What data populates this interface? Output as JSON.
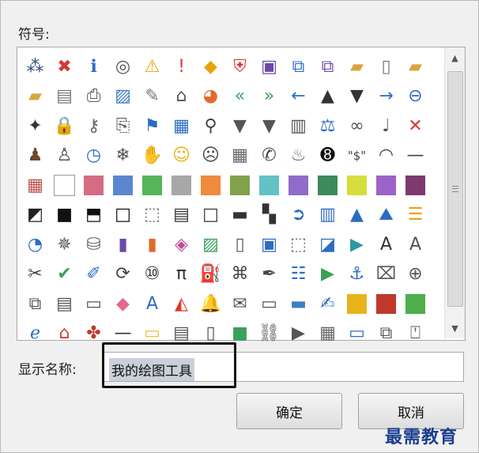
{
  "dialog": {
    "symbols_label": "符号:",
    "display_name_label": "显示名称:",
    "display_name_value": "我的绘图工具",
    "ok_button": "确定",
    "cancel_button": "取消",
    "watermark": "最需教育"
  },
  "scrollbar": {
    "up_arrow": "▲",
    "down_arrow": "▼"
  },
  "symbols": [
    {
      "name": "org-chart-icon",
      "glyph": "⁂",
      "color": "#2b4a78"
    },
    {
      "name": "error-icon",
      "glyph": "✖",
      "color": "#d23a3a"
    },
    {
      "name": "info-icon",
      "glyph": "ℹ",
      "color": "#2b6cc4"
    },
    {
      "name": "target-icon",
      "glyph": "◎",
      "color": "#555555"
    },
    {
      "name": "warning-icon",
      "glyph": "⚠",
      "color": "#e8a20c"
    },
    {
      "name": "exclamation-icon",
      "glyph": "!",
      "color": "#d23a3a"
    },
    {
      "name": "warning-diamond-icon",
      "glyph": "◆",
      "color": "#e8a20c"
    },
    {
      "name": "shield-icon",
      "glyph": "⛨",
      "color": "#d23a3a"
    },
    {
      "name": "save-icon",
      "glyph": "▣",
      "color": "#6b4aa6"
    },
    {
      "name": "save-as-icon",
      "glyph": "⧉",
      "color": "#2b6cc4"
    },
    {
      "name": "save-all-icon",
      "glyph": "⧉",
      "color": "#6b4aa6"
    },
    {
      "name": "folder-icon",
      "glyph": "▰",
      "color": "#d9a441"
    },
    {
      "name": "document-icon",
      "glyph": "▯",
      "color": "#777777"
    },
    {
      "name": "folder-open-icon",
      "glyph": "▰",
      "color": "#d9a441"
    },
    {
      "name": "folders-icon",
      "glyph": "▰",
      "color": "#d9a441"
    },
    {
      "name": "file-manager-icon",
      "glyph": "▤",
      "color": "#777777"
    },
    {
      "name": "printer-icon",
      "glyph": "⎙",
      "color": "#555555"
    },
    {
      "name": "picture-icon",
      "glyph": "▨",
      "color": "#3b7fc4"
    },
    {
      "name": "notes-icon",
      "glyph": "✎",
      "color": "#777777"
    },
    {
      "name": "home-icon",
      "glyph": "⌂",
      "color": "#555555"
    },
    {
      "name": "pie-chart-icon",
      "glyph": "◕",
      "color": "#e06a2a"
    },
    {
      "name": "rewind-icon",
      "glyph": "«",
      "color": "#3aa05a"
    },
    {
      "name": "fast-forward-icon",
      "glyph": "»",
      "color": "#3aa05a"
    },
    {
      "name": "arrow-left-icon",
      "glyph": "←",
      "color": "#2b6cc4"
    },
    {
      "name": "triangle-up-icon",
      "glyph": "▲",
      "color": "#333333"
    },
    {
      "name": "triangle-down-icon",
      "glyph": "▼",
      "color": "#333333"
    },
    {
      "name": "arrow-right-icon",
      "glyph": "→",
      "color": "#2b6cc4"
    },
    {
      "name": "back-circle-icon",
      "glyph": "⊖",
      "color": "#2b6cc4"
    },
    {
      "name": "pin-icon",
      "glyph": "✦",
      "color": "#333333"
    },
    {
      "name": "lock-icon",
      "glyph": "🔒",
      "color": "#d9a441"
    },
    {
      "name": "key-icon",
      "glyph": "⚷",
      "color": "#666666"
    },
    {
      "name": "scroll-icon",
      "glyph": "⎘",
      "color": "#555555"
    },
    {
      "name": "flag-icon",
      "glyph": "⚑",
      "color": "#2b6cc4"
    },
    {
      "name": "table-icon",
      "glyph": "▦",
      "color": "#2b6cc4"
    },
    {
      "name": "magnifier-icon",
      "glyph": "⚲",
      "color": "#444444"
    },
    {
      "name": "filter-icon",
      "glyph": "▼",
      "color": "#555555"
    },
    {
      "name": "filter-icon",
      "glyph": "▼",
      "color": "#555555"
    },
    {
      "name": "book-icon",
      "glyph": "▥",
      "color": "#555555"
    },
    {
      "name": "scales-icon",
      "glyph": "⚖",
      "color": "#2b6cc4"
    },
    {
      "name": "rings-icon",
      "glyph": "∞",
      "color": "#555555"
    },
    {
      "name": "microphone-icon",
      "glyph": "♩",
      "color": "#555555"
    },
    {
      "name": "mute-icon",
      "glyph": "✕",
      "color": "#d23a3a"
    },
    {
      "name": "person-icon",
      "glyph": "♟",
      "color": "#6b4a2a"
    },
    {
      "name": "user-icon",
      "glyph": "♙",
      "color": "#444444"
    },
    {
      "name": "clock-icon",
      "glyph": "◷",
      "color": "#2b6cc4"
    },
    {
      "name": "snowflake-icon",
      "glyph": "❄",
      "color": "#555555"
    },
    {
      "name": "hand-icon",
      "glyph": "✋",
      "color": "#555555"
    },
    {
      "name": "smiley-icon",
      "glyph": "☺",
      "color": "#e8b40c"
    },
    {
      "name": "sad-face-icon",
      "glyph": "☹",
      "color": "#444444"
    },
    {
      "name": "calculator-icon",
      "glyph": "▦",
      "color": "#666666"
    },
    {
      "name": "phone-icon",
      "glyph": "✆",
      "color": "#444444"
    },
    {
      "name": "piggy-bank-icon",
      "glyph": "♨",
      "color": "#666666"
    },
    {
      "name": "eight-ball-icon",
      "glyph": "➑",
      "color": "#111111"
    },
    {
      "name": "dollar-quote-icon",
      "glyph": "\"$\"",
      "color": "#444444"
    },
    {
      "name": "eye-icon",
      "glyph": "◠",
      "color": "#444444"
    },
    {
      "name": "dash-icon",
      "glyph": "—",
      "color": "#444444"
    },
    {
      "name": "color-grid-icon",
      "glyph": "▦",
      "color": "#c0504d"
    },
    {
      "name": "swatch-white-icon",
      "swatch": "#ffffff",
      "color": "#ffffff"
    },
    {
      "name": "swatch-rose-icon",
      "swatch": "#d46c84",
      "color": "#d46c84"
    },
    {
      "name": "swatch-blue-icon",
      "swatch": "#5b86cf",
      "color": "#5b86cf"
    },
    {
      "name": "swatch-green-icon",
      "swatch": "#57b559",
      "color": "#57b559"
    },
    {
      "name": "swatch-gray-icon",
      "swatch": "#a7a7a7",
      "color": "#a7a7a7"
    },
    {
      "name": "swatch-orange-icon",
      "swatch": "#f08a3c",
      "color": "#f08a3c"
    },
    {
      "name": "swatch-olive-icon",
      "swatch": "#82a14a",
      "color": "#82a14a"
    },
    {
      "name": "swatch-teal-icon",
      "swatch": "#62c2c6",
      "color": "#62c2c6"
    },
    {
      "name": "swatch-purple-icon",
      "swatch": "#8f6cc9",
      "color": "#8f6cc9"
    },
    {
      "name": "swatch-darkgreen-icon",
      "swatch": "#3d8a5a",
      "color": "#3d8a5a"
    },
    {
      "name": "swatch-lime-icon",
      "swatch": "#d8dd3e",
      "color": "#d8dd3e"
    },
    {
      "name": "swatch-violet-icon",
      "swatch": "#9c63c8",
      "color": "#9c63c8"
    },
    {
      "name": "swatch-plum-icon",
      "swatch": "#7d3a6e",
      "color": "#7d3a6e"
    },
    {
      "name": "diagonal-fill-icon",
      "glyph": "◩",
      "color": "#222222"
    },
    {
      "name": "black-square-icon",
      "glyph": "■",
      "color": "#111111"
    },
    {
      "name": "half-fill-icon",
      "glyph": "⬒",
      "color": "#111111"
    },
    {
      "name": "bold-frame-icon",
      "glyph": "□",
      "color": "#111111"
    },
    {
      "name": "dotted-frame-icon",
      "glyph": "⬚",
      "color": "#666666"
    },
    {
      "name": "striped-square-icon",
      "glyph": "▤",
      "color": "#333333"
    },
    {
      "name": "outline-square-icon",
      "glyph": "□",
      "color": "#333333"
    },
    {
      "name": "bar-square-icon",
      "glyph": "▬",
      "color": "#333333"
    },
    {
      "name": "checker-icon",
      "glyph": "▚",
      "color": "#333333"
    },
    {
      "name": "arrow-circle-icon",
      "glyph": "➲",
      "color": "#2b6cc4"
    },
    {
      "name": "bar-chart-icon",
      "glyph": "▥",
      "color": "#2b6cc4"
    },
    {
      "name": "cone-icon",
      "glyph": "▲",
      "color": "#2b6cc4"
    },
    {
      "name": "mountain-chart-icon",
      "glyph": "⛰",
      "color": "#2b6cc4"
    },
    {
      "name": "horizontal-bars-icon",
      "glyph": "☰",
      "color": "#e8a20c"
    },
    {
      "name": "pie-icon",
      "glyph": "◔",
      "color": "#2b6cc4"
    },
    {
      "name": "radar-icon",
      "glyph": "✵",
      "color": "#555555"
    },
    {
      "name": "database-icon",
      "glyph": "⛁",
      "color": "#666666"
    },
    {
      "name": "book-purple-icon",
      "glyph": "▮",
      "color": "#6b4aa6"
    },
    {
      "name": "book-orange-icon",
      "glyph": "▮",
      "color": "#e06a2a"
    },
    {
      "name": "shapes-icon",
      "glyph": "◈",
      "color": "#c04a9a"
    },
    {
      "name": "image-landscape-icon",
      "glyph": "▨",
      "color": "#3aa05a"
    },
    {
      "name": "page-icon",
      "glyph": "▯",
      "color": "#555555"
    },
    {
      "name": "contact-card-icon",
      "glyph": "▣",
      "color": "#2b6cc4"
    },
    {
      "name": "dotted-image-icon",
      "glyph": "⬚",
      "color": "#666666"
    },
    {
      "name": "split-shape-icon",
      "glyph": "◪",
      "color": "#2b6cc4"
    },
    {
      "name": "play-split-icon",
      "glyph": "▶",
      "color": "#2b9aa0"
    },
    {
      "name": "text-box-icon",
      "glyph": "A",
      "color": "#333333"
    },
    {
      "name": "text-fill-icon",
      "glyph": "A",
      "color": "#555555"
    },
    {
      "name": "scissors-icon",
      "glyph": "✂",
      "color": "#444444"
    },
    {
      "name": "check-icon",
      "glyph": "✔",
      "color": "#3aa05a"
    },
    {
      "name": "ruler-pencil-icon",
      "glyph": "✐",
      "color": "#2b6cc4"
    },
    {
      "name": "refresh-icon",
      "glyph": "⟳",
      "color": "#444444"
    },
    {
      "name": "binary-icon",
      "glyph": "⑩",
      "color": "#333333"
    },
    {
      "name": "pi-icon",
      "glyph": "π",
      "color": "#333333"
    },
    {
      "name": "paint-bucket-icon",
      "glyph": "⛽",
      "color": "#e8b40c"
    },
    {
      "name": "binoculars-icon",
      "glyph": "⌘",
      "color": "#444444"
    },
    {
      "name": "brush-icon",
      "glyph": "✒",
      "color": "#444444"
    },
    {
      "name": "bullet-list-icon",
      "glyph": "☷",
      "color": "#2b6cc4"
    },
    {
      "name": "play-icon",
      "glyph": "▶",
      "color": "#3aa05a"
    },
    {
      "name": "anchor-icon",
      "glyph": "⚓",
      "color": "#2b6cc4"
    },
    {
      "name": "toolbox-icon",
      "glyph": "⌧",
      "color": "#555555"
    },
    {
      "name": "lasso-add-icon",
      "glyph": "⊕",
      "color": "#555555"
    },
    {
      "name": "copy-icon",
      "glyph": "⧉",
      "color": "#555555"
    },
    {
      "name": "clipboard-text-icon",
      "glyph": "▤",
      "color": "#555555"
    },
    {
      "name": "folder-outline-icon",
      "glyph": "▭",
      "color": "#555555"
    },
    {
      "name": "eraser-icon",
      "glyph": "◆",
      "color": "#e36a8a"
    },
    {
      "name": "font-color-icon",
      "glyph": "A",
      "color": "#2b6cc4"
    },
    {
      "name": "origami-icon",
      "glyph": "◭",
      "color": "#e0392a"
    },
    {
      "name": "bell-icon",
      "glyph": "🔔",
      "color": "#e8a20c"
    },
    {
      "name": "envelope-icon",
      "glyph": "✉",
      "color": "#555555"
    },
    {
      "name": "id-card-icon",
      "glyph": "▭",
      "color": "#555555"
    },
    {
      "name": "window-blue-icon",
      "glyph": "▬",
      "color": "#3b7fc4"
    },
    {
      "name": "signature-icon",
      "glyph": "✍",
      "color": "#2b6cc4"
    },
    {
      "name": "swatch-gold-icon",
      "swatch": "#e8b41c",
      "color": "#e8b41c"
    },
    {
      "name": "swatch-red-striped-icon",
      "swatch": "#c0392b",
      "color": "#c0392b"
    },
    {
      "name": "swatch-bright-green-icon",
      "swatch": "#4cae4c",
      "color": "#4cae4c"
    },
    {
      "name": "internet-explorer-icon",
      "glyph": "ℯ",
      "color": "#2b6cc4"
    },
    {
      "name": "home-network-icon",
      "glyph": "⌂",
      "color": "#d23a3a"
    },
    {
      "name": "signpost-icon",
      "glyph": "✤",
      "color": "#c0392b"
    },
    {
      "name": "line-icon",
      "glyph": "—",
      "color": "#333333"
    },
    {
      "name": "sticky-note-icon",
      "glyph": "▭",
      "color": "#e8c23c"
    },
    {
      "name": "page-settings-icon",
      "glyph": "▤",
      "color": "#555555"
    },
    {
      "name": "clipboard-icon",
      "glyph": "▯",
      "color": "#555555"
    },
    {
      "name": "cube-icon",
      "glyph": "■",
      "color": "#3aa05a"
    },
    {
      "name": "link-check-icon",
      "glyph": "⛓",
      "color": "#555555"
    },
    {
      "name": "camcorder-icon",
      "glyph": "▶",
      "color": "#555555"
    },
    {
      "name": "spreadsheet-icon",
      "glyph": "▦",
      "color": "#666666"
    },
    {
      "name": "window-icon",
      "glyph": "▭",
      "color": "#2b6cc4"
    },
    {
      "name": "windows-stack-icon",
      "glyph": "⧉",
      "color": "#555555"
    },
    {
      "name": "certificate-icon",
      "glyph": "⍞",
      "color": "#555555"
    }
  ]
}
